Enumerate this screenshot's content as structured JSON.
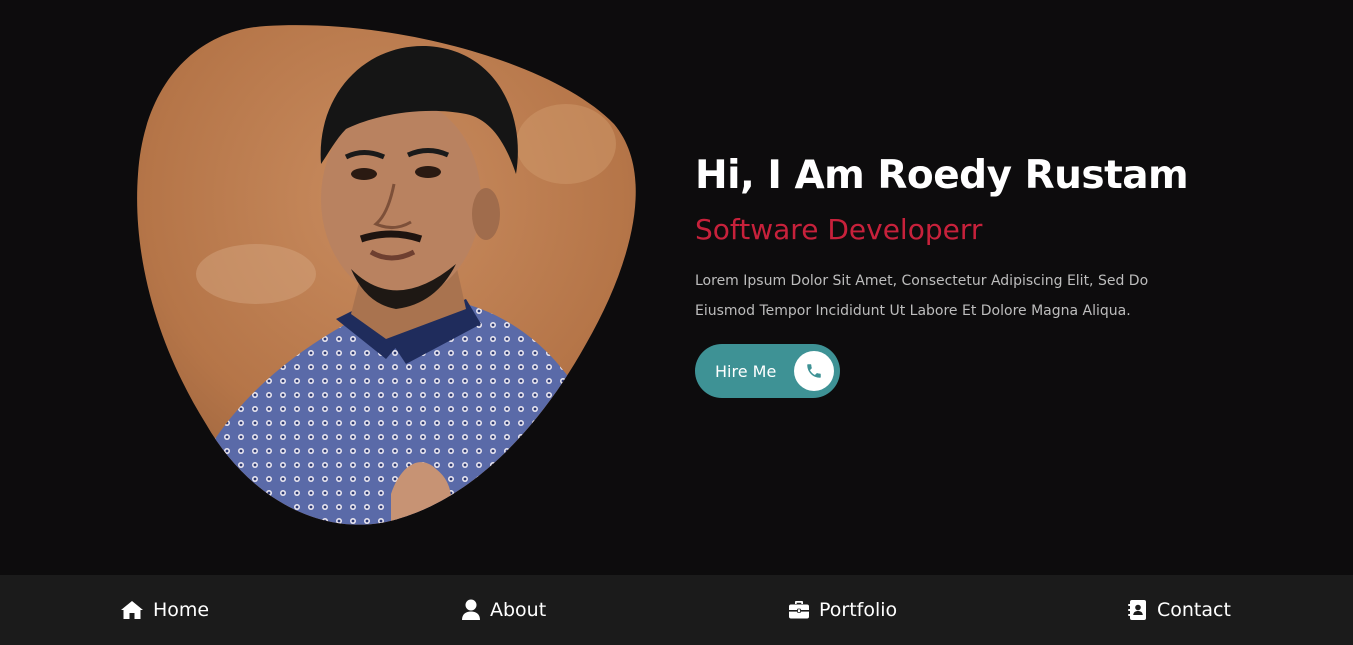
{
  "hero": {
    "greeting": "Hi, I Am Roedy Rustam",
    "role": "Software Developerr",
    "description_line1": "Lorem Ipsum Dolor Sit Amet, Consectetur Adipiscing Elit, Sed Do",
    "description_line2": "Eiusmod Tempor Incididunt Ut Labore Et Dolore Magna Aliqua.",
    "cta_label": "Hire Me",
    "cta_icon": "phone-icon"
  },
  "nav": {
    "items": [
      {
        "label": "Home",
        "icon": "home-icon"
      },
      {
        "label": "About",
        "icon": "user-icon"
      },
      {
        "label": "Portfolio",
        "icon": "briefcase-icon"
      },
      {
        "label": "Contact",
        "icon": "address-book-icon"
      }
    ]
  },
  "colors": {
    "background": "#0d0c0d",
    "nav_background": "#1b1b1b",
    "accent_red": "#c7213b",
    "accent_teal": "#3e9295",
    "text": "#ffffff",
    "muted_text": "#bdbdbd"
  }
}
